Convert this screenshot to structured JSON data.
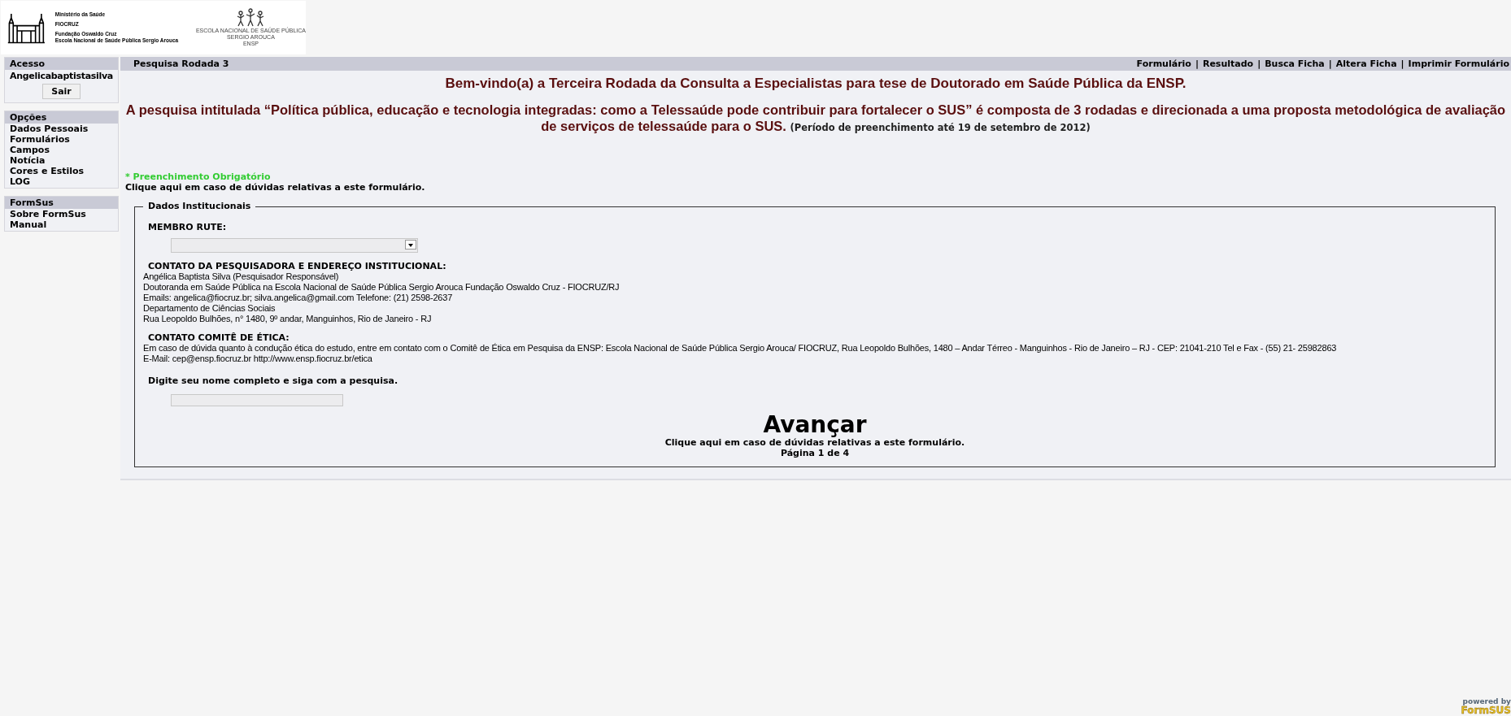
{
  "header": {
    "logo_lines": [
      "Ministério da Saúde",
      "FIOCRUZ",
      "Fundação Oswaldo Cruz",
      "Escola Nacional de Saúde Pública Sergio Arouca"
    ],
    "ensp_lines": [
      "ESCOLA NACIONAL DE SAÚDE PÚBLICA",
      "SERGIO AROUCA",
      "ENSP"
    ]
  },
  "sidebar": {
    "sections": [
      {
        "title": "Acesso",
        "kind": "login",
        "user": "Angelicabaptistasilva",
        "button": "Sair"
      },
      {
        "title": "Opções",
        "kind": "menu",
        "items": [
          "Dados Pessoais",
          "Formulários",
          "Campos",
          "Notícia",
          "Cores e Estilos",
          "LOG"
        ]
      },
      {
        "title": "FormSus",
        "kind": "menu",
        "items": [
          "Sobre FormSus",
          "Manual"
        ]
      }
    ]
  },
  "top_bar": {
    "title": "Pesquisa Rodada 3",
    "separator": "|",
    "links": [
      "Formulário",
      "Resultado",
      "Busca Ficha",
      "Altera Ficha",
      "Imprimir Formulário"
    ]
  },
  "intro": {
    "title": "Bem-vindo(a) a Terceira Rodada da Consulta a Especialistas para tese de Doutorado em Saúde Pública da ENSP.",
    "text": "A pesquisa  intitulada “Política pública, educação e tecnologia integradas: como a Telessaúde pode contribuir para fortalecer o SUS”  é composta de 3 rodadas e direcionada a uma proposta metodológica de avaliação de serviços de telessaúde para o SUS.",
    "note": "(Período de preenchimento até 19 de setembro de 2012)"
  },
  "required_note": "* Preenchimento Obrigatório",
  "help_link": "Clique aqui em caso de dúvidas relativas a este formulário.",
  "fieldset": {
    "legend": "Dados Institucionais",
    "blocks": [
      {
        "kind": "select",
        "label": "MEMBRO RUTE:"
      },
      {
        "kind": "info",
        "heading": "CONTATO DA PESQUISADORA E ENDEREÇO INSTITUCIONAL:",
        "lines": [
          "Angélica Baptista Silva (Pesquisador Responsável)",
          "Doutoranda em Saúde Pública na Escola Nacional de Saúde Pública Sergio Arouca Fundação Oswaldo Cruz - FIOCRUZ/RJ",
          "Emails: angelica@fiocruz.br; silva.angelica@gmail.com Telefone: (21) 2598-2637",
          "Departamento de Ciências Sociais",
          "Rua Leopoldo Bulhões, n° 1480, 9º andar, Manguinhos, Rio de Janeiro - RJ"
        ]
      },
      {
        "kind": "info",
        "heading": "CONTATO COMITÊ DE ÉTICA:",
        "lines": [
          "Em caso de dúvida quanto à condução ética do estudo, entre em contato com o Comitê de Ética em Pesquisa da ENSP: Escola Nacional de Saúde Pública Sergio Arouca/ FIOCRUZ, Rua Leopoldo Bulhões, 1480 – Andar Térreo - Manguinhos - Rio de Janeiro – RJ - CEP: 21041-210 Tel e Fax - (55) 21- 25982863",
          "E-Mail: cep@ensp.fiocruz.br http://www.ensp.fiocruz.br/etica"
        ]
      },
      {
        "kind": "text",
        "label": "Digite seu nome completo e siga com a pesquisa."
      }
    ],
    "next_button": "Avançar",
    "help_link": "Clique aqui em caso de dúvidas relativas a este formulário.",
    "page": "Página 1 de 4"
  },
  "footer": {
    "powered_by": "powered by",
    "brand": "FormSUS"
  }
}
